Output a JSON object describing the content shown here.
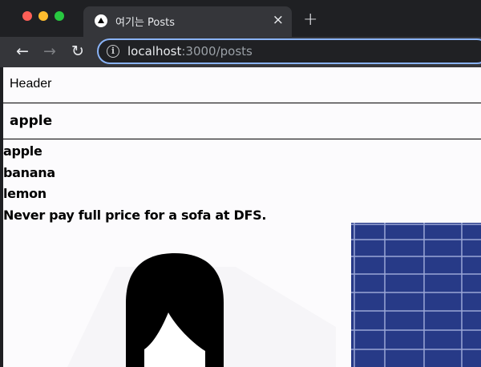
{
  "browser": {
    "tab": {
      "title": "여기는 Posts",
      "close": "×"
    },
    "new_tab": "+",
    "nav": {
      "back": "←",
      "forward": "→",
      "reload": "↻"
    },
    "url": {
      "host": "localhost",
      "path": ":3000/posts",
      "info": "i"
    }
  },
  "page": {
    "header": "Header",
    "subheader": "apple",
    "items": [
      "apple",
      "banana",
      "lemon",
      "Never pay full price for a sofa at DFS."
    ]
  }
}
